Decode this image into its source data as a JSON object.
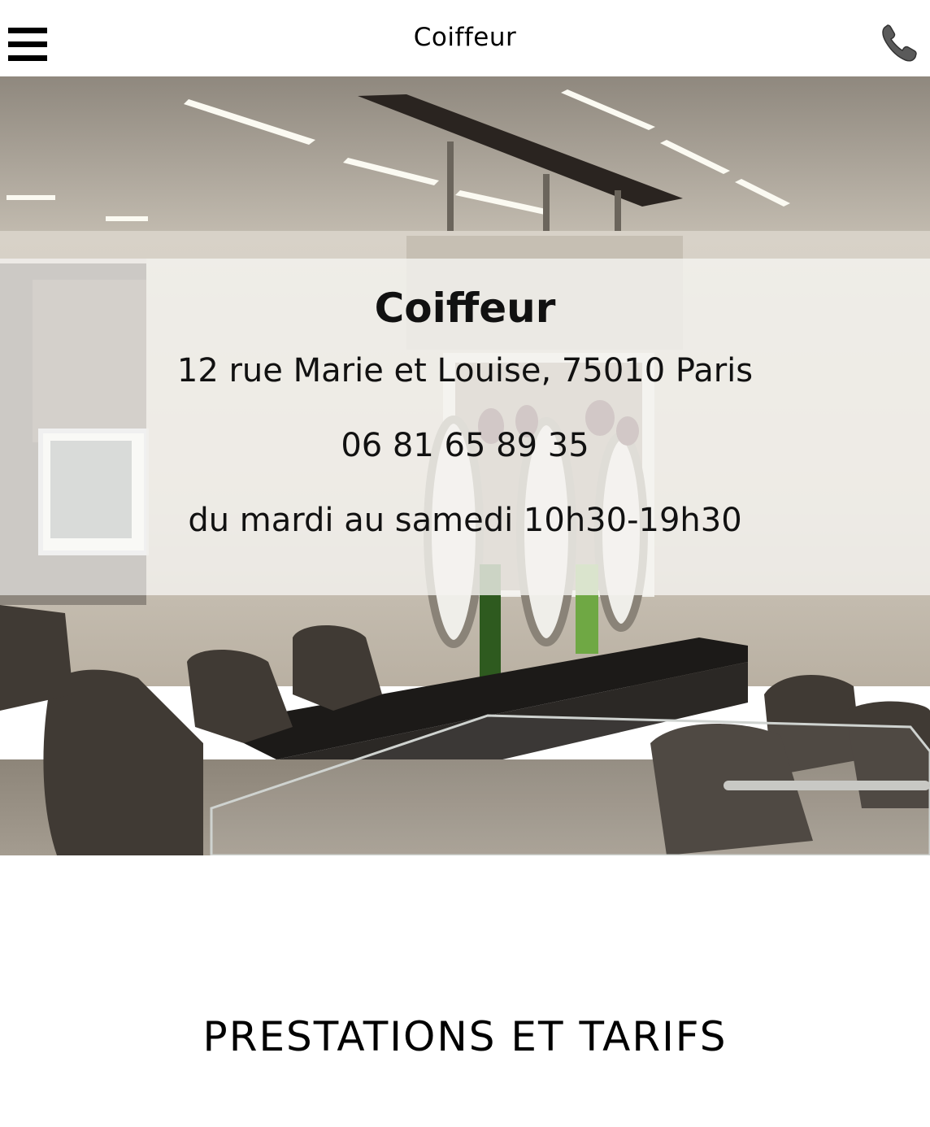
{
  "header": {
    "title": "Coiffeur",
    "menu_icon": "hamburger-icon",
    "phone_icon": "phone-icon"
  },
  "hero": {
    "name": "Coiffeur",
    "address": "12 rue Marie et Louise, 75010 Paris",
    "phone": "06 81 65 89 35",
    "hours": "du mardi au samedi 10h30-19h30"
  },
  "section": {
    "title": "PRESTATIONS ET TARIFS"
  }
}
